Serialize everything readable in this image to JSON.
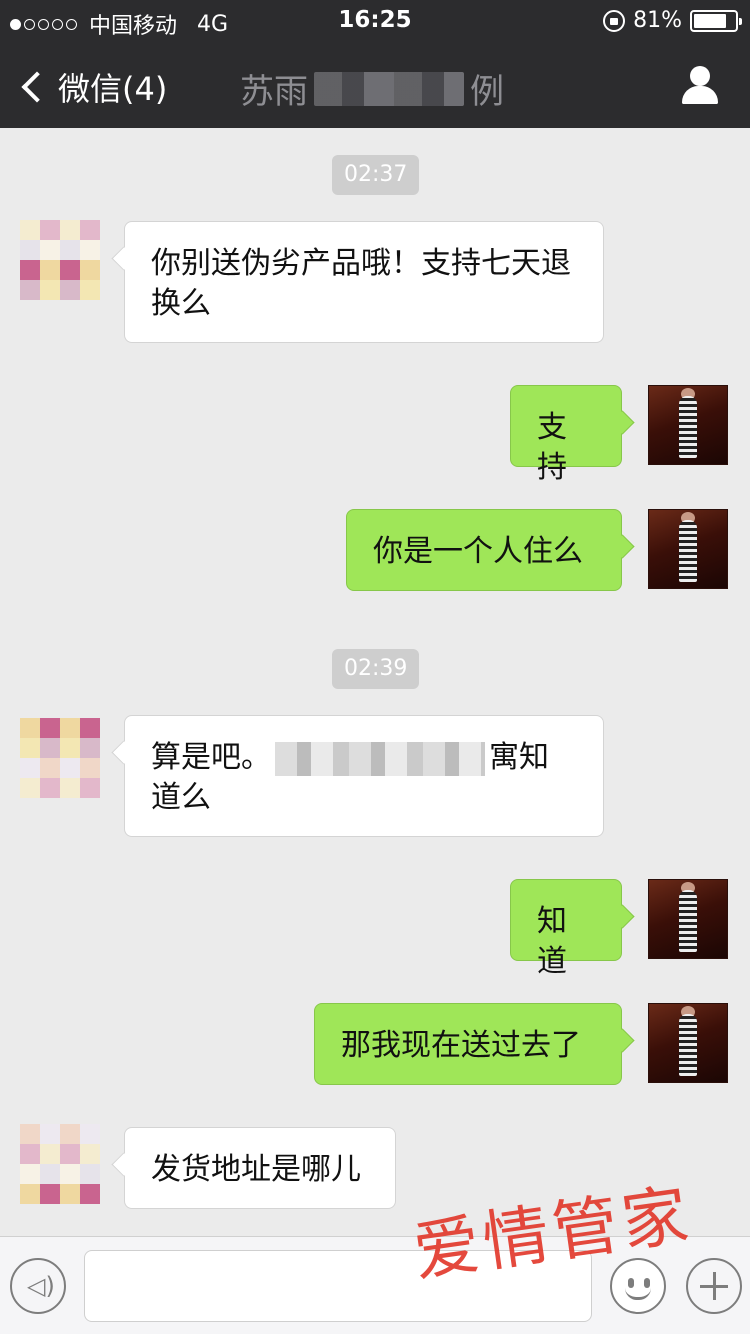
{
  "status_bar": {
    "carrier": "中国移动",
    "network": "4G",
    "time": "16:25",
    "battery": "81%",
    "battery_level": 0.81
  },
  "nav": {
    "back_label": "微信(4)",
    "title_visible_start": "苏雨",
    "title_visible_end": "例"
  },
  "messages": [
    {
      "type": "timestamp",
      "text": "02:37"
    },
    {
      "side": "left",
      "text": "你别送伪劣产品哦！支持七天退换么"
    },
    {
      "side": "right",
      "text": "支持"
    },
    {
      "side": "right",
      "text": "你是一个人住么"
    },
    {
      "type": "timestamp",
      "text": "02:39"
    },
    {
      "side": "left",
      "text_start": "算是吧。",
      "text_end": "寓知道么"
    },
    {
      "side": "right",
      "text": "知道"
    },
    {
      "side": "right",
      "text": "那我现在送过去了"
    },
    {
      "side": "left",
      "text": "发货地址是哪儿"
    }
  ],
  "watermark": "爱情管家",
  "colors": {
    "nav_bg": "#2c2c2e",
    "chat_bg": "#ebebeb",
    "bubble_right": "#9fe658",
    "bubble_left": "#ffffff",
    "watermark": "#e23a2d"
  },
  "icons": [
    "signal-dots-icon",
    "orientation-lock-icon",
    "battery-icon",
    "back-chevron-icon",
    "person-icon",
    "voice-icon",
    "emoji-icon",
    "plus-icon"
  ]
}
